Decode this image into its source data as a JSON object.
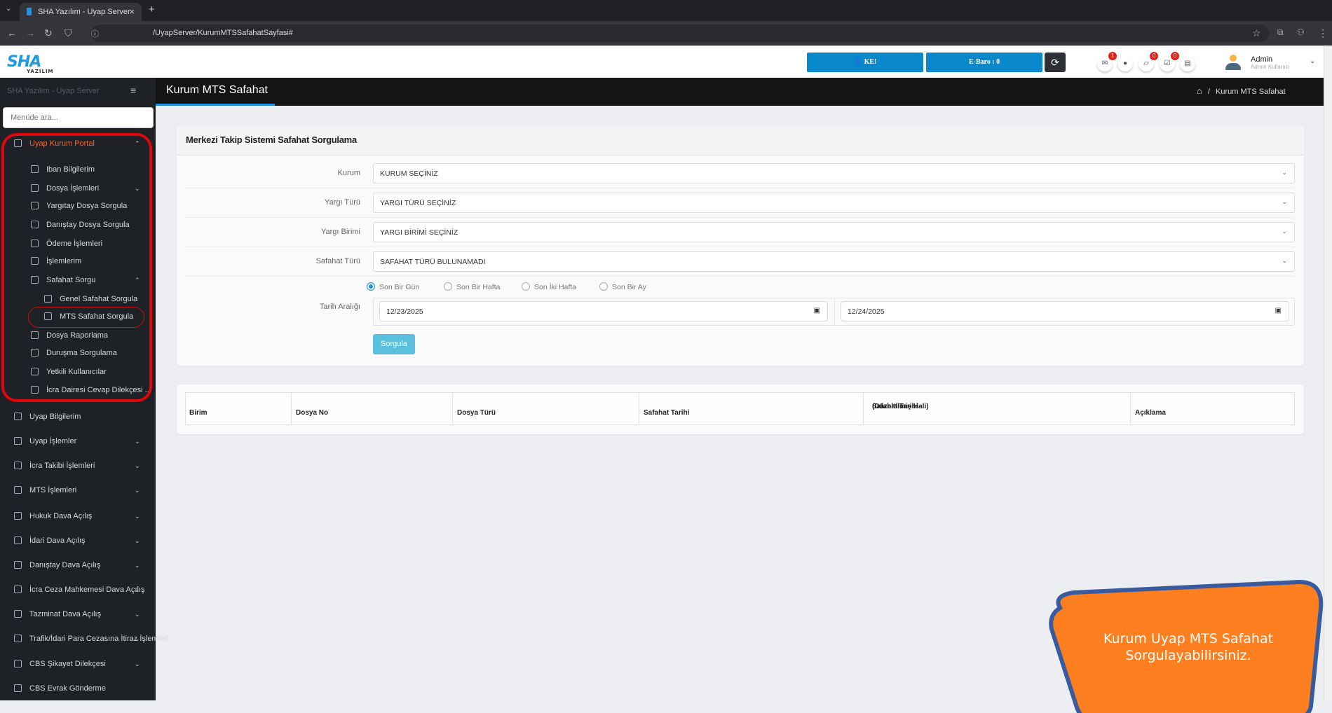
{
  "browser": {
    "tab_title": "SHA Yazılım - Uyap Server",
    "new_tab": "+",
    "url": "/UyapServer/KurumMTSSafahatSayfasi#"
  },
  "header": {
    "logo_text": "SHA",
    "logo_sub": "YAZILIM",
    "ke_button": "KE!",
    "ebaro_button": "E-Baro : 0",
    "notifications": [
      {
        "icon": "mail-icon",
        "count": "1"
      },
      {
        "icon": "clock-icon",
        "count": ""
      },
      {
        "icon": "note-icon",
        "count": "0"
      },
      {
        "icon": "clipboard-icon",
        "count": "0"
      },
      {
        "icon": "document-icon",
        "count": ""
      }
    ],
    "user_name": "Admin",
    "user_role": "Admin Kullanıcı"
  },
  "sidebar": {
    "title": "SHA Yazılım - Uyap Server",
    "search_placeholder": "Menüde ara...",
    "items": [
      {
        "label": "Uyap Kurum Portal",
        "chevron": "^"
      },
      {
        "label": "Iban Bilgilerim"
      },
      {
        "label": "Dosya İşlemleri",
        "chevron": "v"
      },
      {
        "label": "Yargıtay Dosya Sorgula"
      },
      {
        "label": "Danıştay Dosya Sorgula"
      },
      {
        "label": "Ödeme İşlemleri"
      },
      {
        "label": "İşlemlerim"
      },
      {
        "label": "Safahat Sorgu",
        "chevron": "^"
      },
      {
        "label": "Genel Safahat Sorgula"
      },
      {
        "label": "MTS Safahat Sorgula"
      },
      {
        "label": "Dosya Raporlama"
      },
      {
        "label": "Duruşma Sorgulama"
      },
      {
        "label": "Yetkili Kullanıcılar"
      },
      {
        "label": "İcra Dairesi Cevap Dilekçesi ..."
      },
      {
        "label": "Uyap Bilgilerim"
      },
      {
        "label": "Uyap İşlemler",
        "chevron": "v"
      },
      {
        "label": "İcra Takibi İşlemleri",
        "chevron": "v"
      },
      {
        "label": "MTS İşlemleri",
        "chevron": "v"
      },
      {
        "label": "Hukuk Dava Açılış",
        "chevron": "v"
      },
      {
        "label": "İdari Dava Açılış",
        "chevron": "v"
      },
      {
        "label": "Danıştay Dava Açılış",
        "chevron": "v"
      },
      {
        "label": "İcra Ceza Mahkemesi Dava Açılış",
        "chevron": "v"
      },
      {
        "label": "Tazminat Dava Açılış",
        "chevron": "v"
      },
      {
        "label": "Trafik/İdari Para Cezasına İtiraz İşlemleri",
        "chevron": "v"
      },
      {
        "label": "CBS Şikayet Dilekçesi",
        "chevron": "v"
      },
      {
        "label": "CBS Evrak Gönderme"
      }
    ]
  },
  "page": {
    "title": "Kurum MTS Safahat",
    "breadcrumb": "Kurum MTS Safahat",
    "breadcrumb_sep": "/"
  },
  "form": {
    "title": "Merkezi Takip Sistemi Safahat Sorgulama",
    "fields": [
      {
        "label": "Kurum",
        "value": "KURUM SEÇİNİZ"
      },
      {
        "label": "Yargı Türü",
        "value": "YARGI TÜRÜ SEÇİNİZ"
      },
      {
        "label": "Yargı Birimi",
        "value": "YARGI BİRİMİ SEÇİNİZ"
      },
      {
        "label": "Safahat Türü",
        "value": "SAFAHAT TÜRÜ BULUNAMADI"
      }
    ],
    "date_label": "Tarih Aralığı",
    "radios": [
      "Son Bir Gün",
      "Son Bir Hafta",
      "Son İki Hafta",
      "Son Bir Ay"
    ],
    "selected_radio": "Son Bir Gün",
    "date_from": "12/23/2025",
    "date_to": "12/24/2025",
    "submit": "Sorgula"
  },
  "table": {
    "headers": [
      "Birim",
      "Dosya No",
      "Dosya Türü",
      "Safahat Tarihi",
      "Safahat Tarihi",
      "Açıklama"
    ],
    "header_sub": "(Düzeltilmiş Hali)"
  },
  "callout": {
    "line1": "Kurum Uyap MTS Safahat",
    "line2": "Sorgulayabilirsiniz.",
    "fill": "#fe7f1f",
    "border": "#3a5aa0"
  },
  "colors": {
    "accent": "#0a88cc",
    "highlight": "#e1060b"
  }
}
